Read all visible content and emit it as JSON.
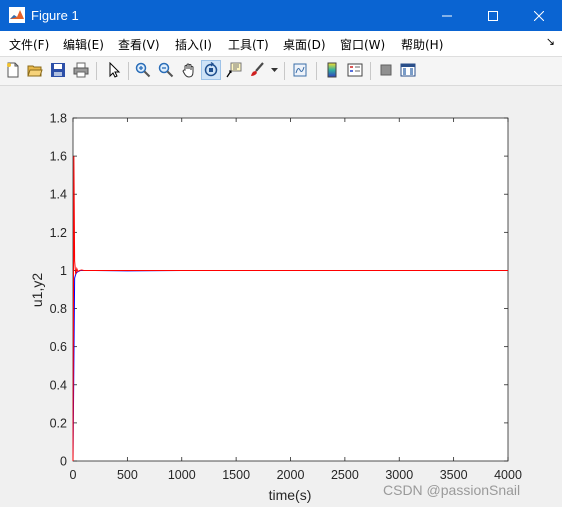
{
  "window": {
    "title": "Figure 1"
  },
  "menu": {
    "items": [
      "文件(F)",
      "编辑(E)",
      "查看(V)",
      "插入(I)",
      "工具(T)",
      "桌面(D)",
      "窗口(W)",
      "帮助(H)"
    ],
    "more": "↘"
  },
  "toolbar": {
    "tools": [
      "new-figure-icon",
      "open-file-icon",
      "save-icon",
      "print-icon",
      "edit-plot-cursor-icon",
      "zoom-in-icon",
      "zoom-out-icon",
      "pan-hand-icon",
      "rotate-3d-icon",
      "data-cursor-icon",
      "brush-icon",
      "link-plot-icon",
      "insert-colorbar-icon",
      "insert-legend-icon",
      "hide-plot-tools-icon",
      "show-plot-tools-icon"
    ]
  },
  "chart_data": {
    "type": "line",
    "xlabel": "time(s)",
    "ylabel": "u1,y2",
    "xlim": [
      0,
      4000
    ],
    "ylim": [
      0,
      1.8
    ],
    "xticks": [
      "0",
      "500",
      "1000",
      "1500",
      "2000",
      "2500",
      "3000",
      "3500",
      "4000"
    ],
    "yticks": [
      "0",
      "0.2",
      "0.4",
      "0.6",
      "0.8",
      "1",
      "1.2",
      "1.4",
      "1.6",
      "1.8"
    ],
    "grid": false,
    "series": [
      {
        "color": "#ff0000",
        "x": [
          0,
          8,
          15,
          25,
          35,
          45,
          60,
          80,
          100,
          150,
          300,
          1000,
          2000,
          3000,
          4000
        ],
        "y": [
          0,
          1.6,
          1.05,
          0.98,
          1.01,
          0.995,
          1.0,
          1.002,
          1.0,
          1.0,
          1.0,
          1.0,
          1.0,
          1.0,
          1.0
        ]
      },
      {
        "color": "#0000ff",
        "x": [
          0,
          15,
          25,
          35,
          50,
          70,
          100,
          200,
          500,
          1000,
          2000,
          3000,
          4000
        ],
        "y": [
          0,
          0.96,
          0.98,
          0.99,
          0.995,
          1.0,
          1.0,
          1.0,
          0.998,
          1.0,
          1.0,
          1.0,
          1.0
        ]
      }
    ]
  },
  "watermark": "CSDN @passionSnail"
}
